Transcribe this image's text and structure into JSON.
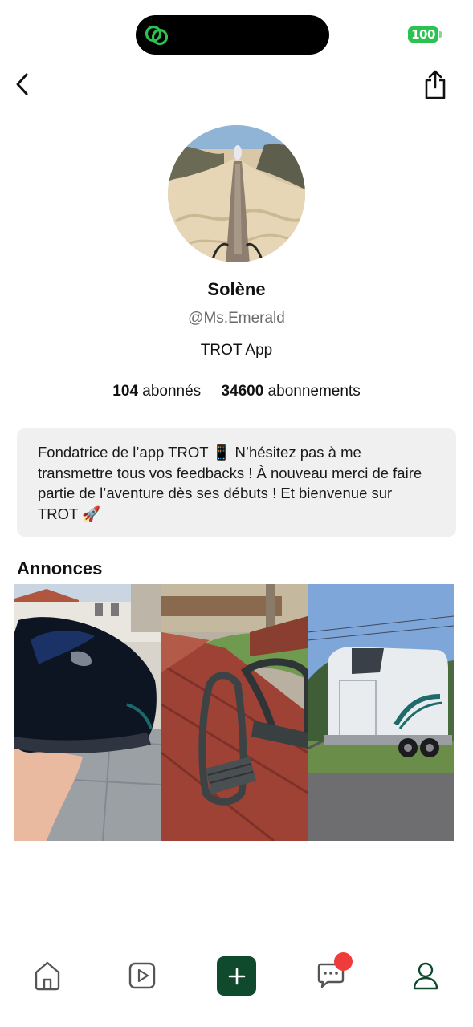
{
  "status_bar": {
    "battery": "100",
    "accent": "#2bc24f"
  },
  "header": {
    "back_icon": "chevron-left-icon",
    "share_icon": "share-icon"
  },
  "profile": {
    "name": "Solène",
    "handle": "@Ms.Emerald",
    "subtitle": "TROT App",
    "followers_count": "104",
    "followers_label": "abonnés",
    "following_count": "34600",
    "following_label": "abonnements",
    "bio": "Fondatrice de l’app TROT 📱 N’hésitez pas à me transmettre tous vos feedbacks ! À nouveau merci de faire partie de l’aventure dès ses débuts ! Et bienvenue sur TROT 🚀"
  },
  "listings": {
    "title": "Annonces",
    "items": [
      {
        "image": "helmet-photo"
      },
      {
        "image": "stirrups-photo"
      },
      {
        "image": "horse-trailer-photo"
      }
    ]
  },
  "bottom_nav": {
    "items": [
      {
        "icon": "home-icon"
      },
      {
        "icon": "play-icon"
      },
      {
        "icon": "plus-icon"
      },
      {
        "icon": "chat-icon",
        "has_notification": true
      },
      {
        "icon": "user-icon",
        "active": true
      }
    ],
    "accent": "#0f4a2c",
    "badge_color": "#f03b3b"
  }
}
